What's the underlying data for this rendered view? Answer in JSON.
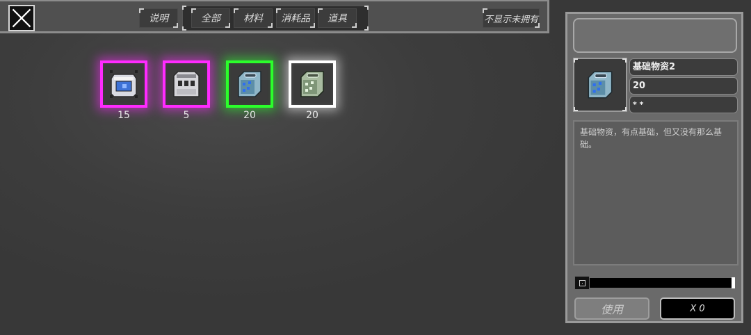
{
  "toolbar": {
    "help_label": "说明",
    "tabs": [
      {
        "label": "全部"
      },
      {
        "label": "材料"
      },
      {
        "label": "消耗品"
      },
      {
        "label": "道具"
      }
    ],
    "hide_unowned_label": "不显示未拥有"
  },
  "inventory": {
    "items": [
      {
        "icon": "blue-screen-crate-icon",
        "count": "15",
        "rarity_color": "#ff2bff"
      },
      {
        "icon": "white-storage-crate-icon",
        "count": "5",
        "rarity_color": "#ff2bff"
      },
      {
        "icon": "blue-supply-cube-icon",
        "count": "20",
        "rarity_color": "#2bff2b"
      },
      {
        "icon": "green-supply-cube-icon",
        "count": "20",
        "rarity_color": "#ffffff"
      }
    ]
  },
  "detail": {
    "name": "基础物资2",
    "count": "20",
    "stars": "* *",
    "description": "基础物资，有点基础，但又没有那么基础。",
    "use_label": "使用",
    "quantity_label": "X 0",
    "quantity_value": 0
  }
}
